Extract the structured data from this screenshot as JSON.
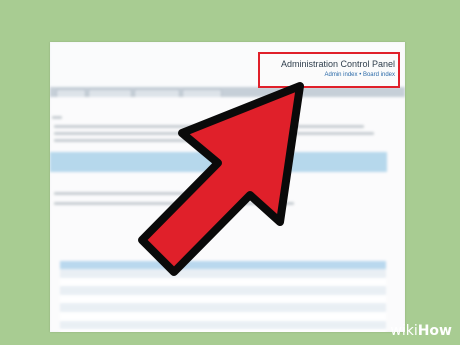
{
  "acp": {
    "title": "Administration Control Panel",
    "link_admin_index": "Admin index",
    "separator": "•",
    "link_board_index": "Board index"
  },
  "watermark": {
    "wiki": "wiki",
    "how": "How"
  },
  "colors": {
    "highlight_border": "#e0202a",
    "arrow_fill": "#e0202a",
    "background": "#a8cc92"
  }
}
